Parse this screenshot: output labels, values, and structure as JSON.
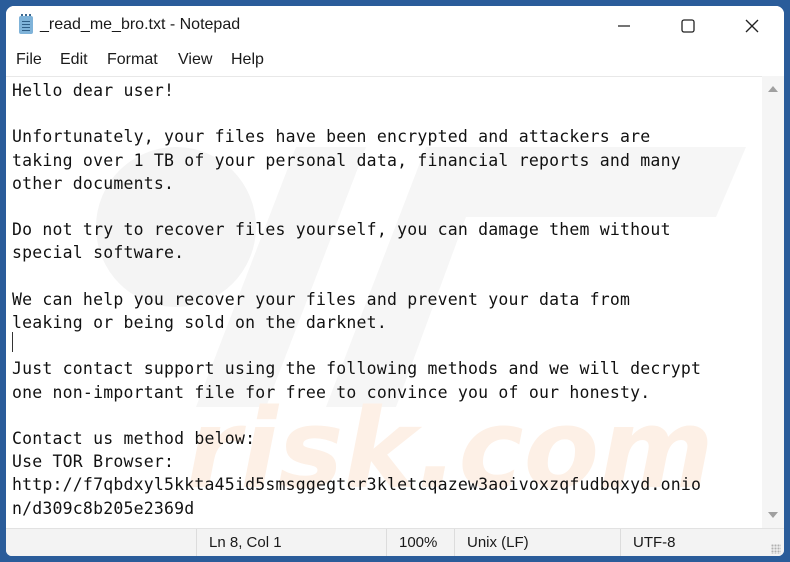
{
  "window": {
    "title": "_read_me_bro.txt - Notepad",
    "app_icon": "notepad-icon",
    "controls": {
      "minimize": "minimize-icon",
      "maximize": "maximize-icon",
      "close": "close-icon"
    }
  },
  "menu": {
    "items": [
      {
        "label": "File"
      },
      {
        "label": "Edit"
      },
      {
        "label": "Format"
      },
      {
        "label": "View"
      },
      {
        "label": "Help"
      }
    ]
  },
  "editor": {
    "lines": [
      "Hello dear user!",
      "",
      "Unfortunately, your files have been encrypted and attackers are",
      "taking over 1 TB of your personal data, financial reports and many",
      "other documents.",
      "",
      "Do not try to recover files yourself, you can damage them without",
      "special software.",
      "",
      "We can help you recover your files and prevent your data from",
      "leaking or being sold on the darknet.",
      "",
      "Just contact support using the following methods and we will decrypt",
      "one non-important file for free to convince you of our honesty.",
      "",
      "Contact us method below:",
      "Use TOR Browser:",
      "http://f7qbdxyl5kkta45id5smsggegtcr3kletcqazew3aoivoxzqfudbqxyd.onio",
      "n/d309c8b205e2369d"
    ],
    "watermark": "pcrisk.com"
  },
  "status": {
    "position": "Ln 8, Col 1",
    "zoom": "100%",
    "line_ending": "Unix (LF)",
    "encoding": "UTF-8"
  }
}
